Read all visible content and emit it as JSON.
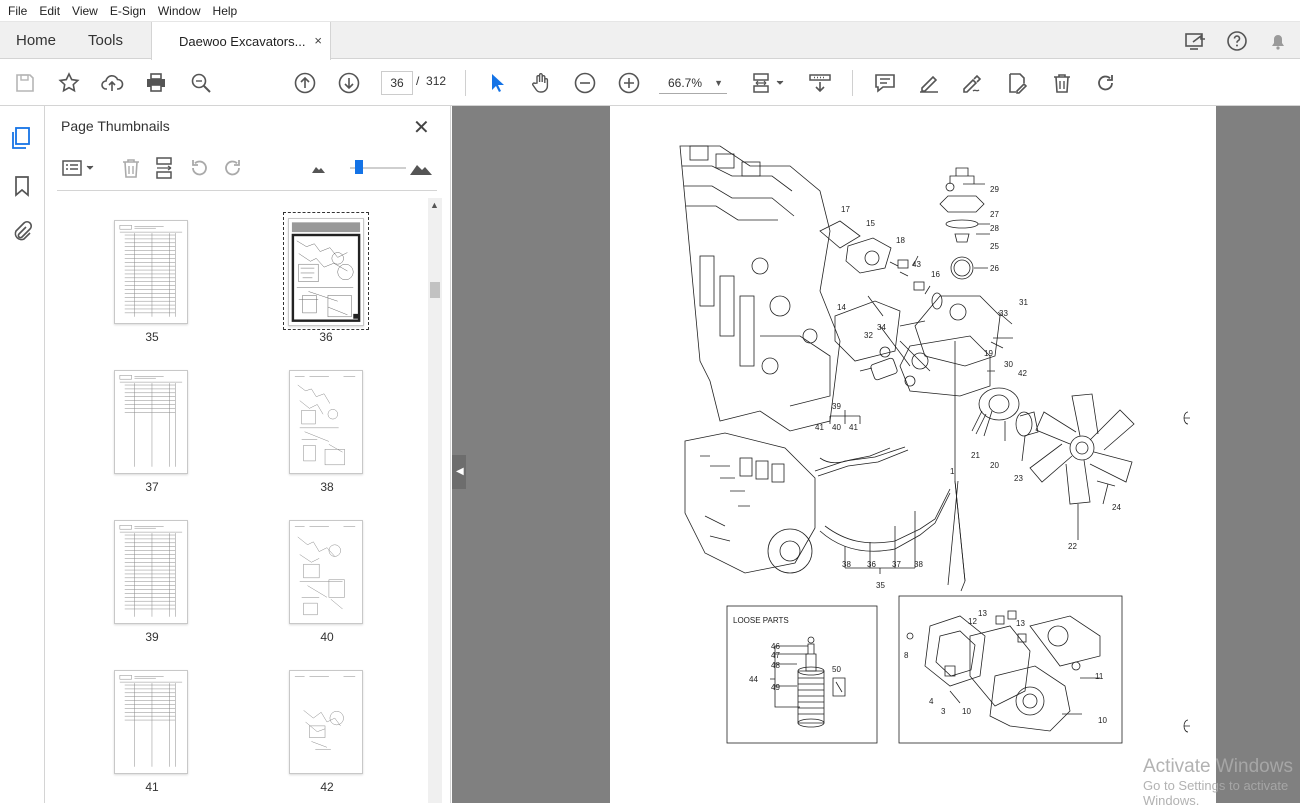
{
  "menu": [
    "File",
    "Edit",
    "View",
    "E-Sign",
    "Window",
    "Help"
  ],
  "tabs": {
    "home": "Home",
    "tools": "Tools",
    "document": "Daewoo Excavators...",
    "close": "×"
  },
  "toolbar": {
    "current_page": "36",
    "page_sep": "/",
    "page_total": "312",
    "zoom": "66.7%",
    "zoom_caret": "▼"
  },
  "panel": {
    "title": "Page Thumbnails",
    "close": "✕",
    "thumbnails": [
      {
        "label": "35",
        "kind": "parts-list",
        "selected": false
      },
      {
        "label": "36",
        "kind": "diagram",
        "selected": true
      },
      {
        "label": "37",
        "kind": "parts-list",
        "selected": false
      },
      {
        "label": "38",
        "kind": "diagram",
        "selected": false
      },
      {
        "label": "39",
        "kind": "parts-list",
        "selected": false
      },
      {
        "label": "40",
        "kind": "diagram",
        "selected": false
      },
      {
        "label": "41",
        "kind": "parts-list",
        "selected": false
      },
      {
        "label": "42",
        "kind": "diagram",
        "selected": false
      }
    ]
  },
  "diagram": {
    "callouts": [
      "29",
      "27",
      "28",
      "25",
      "26",
      "17",
      "15",
      "18",
      "43",
      "16",
      "31",
      "33",
      "14",
      "34",
      "32",
      "19",
      "30",
      "42",
      "21",
      "20",
      "23",
      "24",
      "22",
      "1",
      "39",
      "41",
      "40",
      "41",
      "38",
      "36",
      "37",
      "38",
      "35",
      "13",
      "12",
      "13",
      "8",
      "11",
      "4",
      "3",
      "10",
      "10"
    ],
    "loose_parts_title": "LOOSE PARTS",
    "loose_callouts": [
      "46",
      "47",
      "48",
      "44",
      "49",
      "50"
    ]
  },
  "watermark": {
    "line1": "Activate Windows",
    "line2": "Go to Settings to activate Windows."
  },
  "colors": {
    "accent": "#1473e6",
    "viewer_bg": "#808080",
    "tab_bg": "#f0f0f0"
  }
}
